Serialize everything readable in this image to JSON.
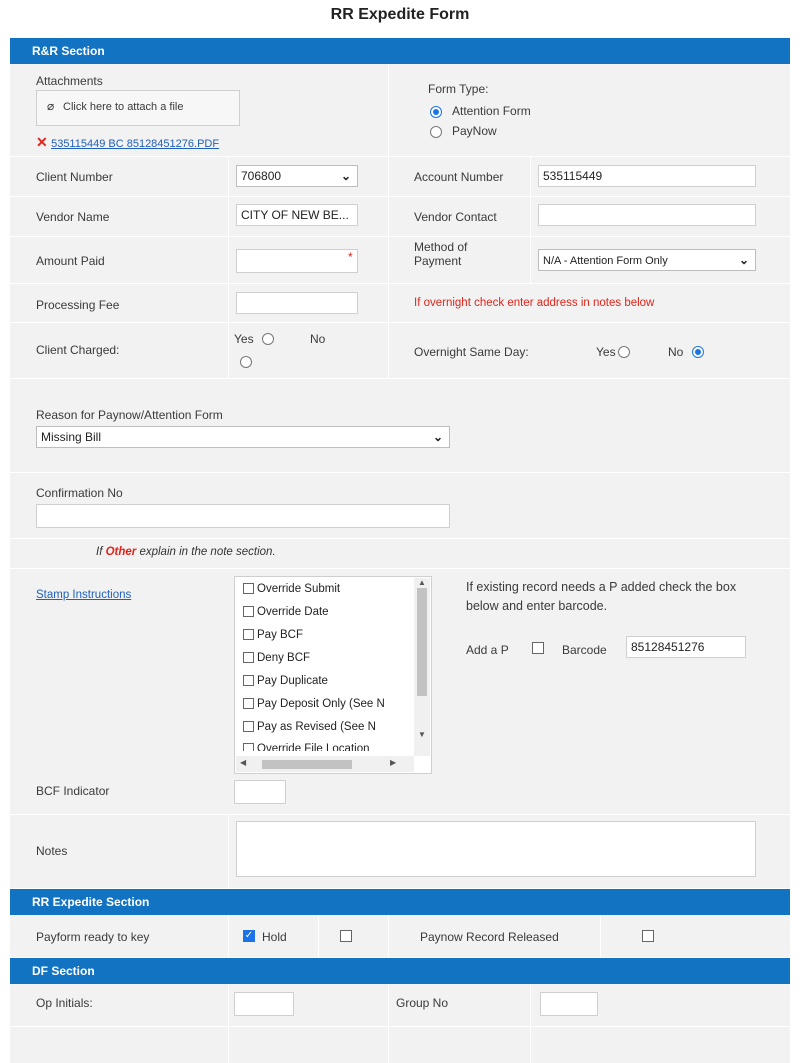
{
  "form": {
    "title": "RR Expedite Form"
  },
  "sections": {
    "rr": "R&R Section",
    "expedite": "RR Expedite Section",
    "df": "DF Section"
  },
  "attachments": {
    "label": "Attachments",
    "button_label": "Click here to attach a file",
    "file_name": "535115449 BC 85128451276.PDF"
  },
  "form_type": {
    "label": "Form Type:",
    "options": [
      "Attention Form",
      "PayNow"
    ],
    "selected": "Attention Form"
  },
  "fields": {
    "client_number": {
      "label": "Client Number",
      "value": "706800"
    },
    "account_number": {
      "label": "Account Number",
      "value": "535115449"
    },
    "vendor_name": {
      "label": "Vendor Name",
      "value": "CITY OF NEW BE..."
    },
    "vendor_contact": {
      "label": "Vendor Contact",
      "value": ""
    },
    "amount_paid": {
      "label": "Amount Paid",
      "value": "",
      "required_mark": "*"
    },
    "method_of_payment": {
      "label": "Method of Payment",
      "value": "N/A - Attention Form Only"
    },
    "processing_fee": {
      "label": "Processing Fee",
      "value": ""
    },
    "overnight_note": "If overnight check enter address in notes below",
    "client_charged": {
      "label": "Client Charged:",
      "yes": "Yes",
      "no": "No"
    },
    "overnight_same_day": {
      "label": "Overnight Same Day:",
      "yes": "Yes",
      "no": "No",
      "selected": "No"
    },
    "reason": {
      "label": "Reason for Paynow/Attention Form",
      "value": "Missing Bill"
    },
    "confirmation_no": {
      "label": "Confirmation No",
      "value": ""
    },
    "other_note": {
      "prefix": "If ",
      "highlight": "Other",
      "suffix": " explain in the note section."
    },
    "stamp_link": "Stamp Instructions",
    "stamp_options": [
      "Override Submit",
      "Override Date",
      "Pay BCF",
      "Deny BCF",
      "Pay Duplicate",
      "Pay Deposit Only (See N",
      "Pay as Revised (See N",
      "Override File Location"
    ],
    "existing_record_note": "If existing record needs a P added check the box below and enter barcode.",
    "add_p": {
      "label": "Add a P"
    },
    "barcode": {
      "label": "Barcode",
      "value": "85128451276"
    },
    "bcf_indicator": {
      "label": "BCF Indicator",
      "value": ""
    },
    "notes": {
      "label": "Notes",
      "value": ""
    }
  },
  "expedite": {
    "payform_label": "Payform ready to key",
    "hold_label": "Hold",
    "paynow_released_label": "Paynow Record Released"
  },
  "df": {
    "op_initials": {
      "label": "Op Initials:",
      "value": ""
    },
    "group_no": {
      "label": "Group No",
      "value": ""
    }
  },
  "colors": {
    "header": "#1273c3",
    "panel": "#f2f2f2",
    "alert": "#e0251b",
    "link": "#1f5fbf"
  }
}
